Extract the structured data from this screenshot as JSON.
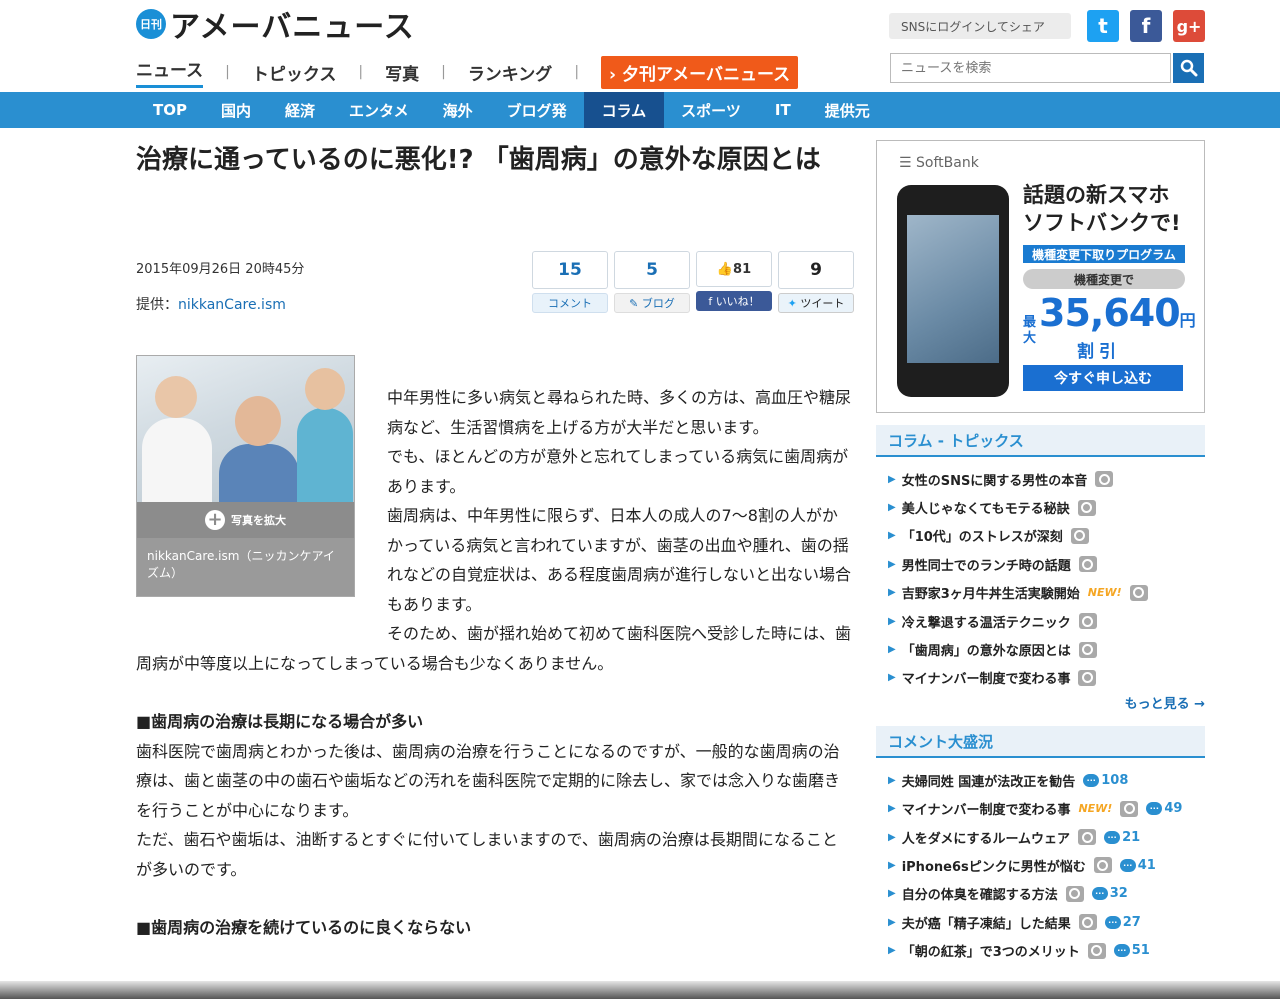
{
  "header": {
    "logo_badge": "日刊",
    "logo_text": "アメーバニュース",
    "share_label": "SNSにログインしてシェア",
    "sns": {
      "twitter": "t",
      "facebook": "f",
      "google": "g+"
    },
    "search_placeholder": "ニュースを検索",
    "nav": [
      "ニュース",
      "トピックス",
      "写真",
      "ランキング"
    ],
    "yukan_label": "夕刊アメーバニュース"
  },
  "categories": [
    "TOP",
    "国内",
    "経済",
    "エンタメ",
    "海外",
    "ブログ発",
    "コラム",
    "スポーツ",
    "IT",
    "提供元"
  ],
  "article": {
    "title": "治療に通っているのに悪化!? 「歯周病」の意外な原因とは",
    "date": "2015年09月26日 20時45分",
    "source_label": "提供：",
    "source_name": "nikkanCare.ism",
    "counts": {
      "comment": "15",
      "comment_label": "コメント",
      "blog": "5",
      "blog_label": "ブログ",
      "like": "81",
      "like_label": "いいね！",
      "tweet": "9",
      "tweet_label": "ツイート"
    },
    "photo_enlarge": "写真を拡大",
    "photo_caption": "nikkanCare.ism（ニッカンケアイズム）",
    "paragraphs": [
      "中年男性に多い病気と尋ねられた時、多くの方は、高血圧や糖尿病など、生活習慣病を上げる方が大半だと思います。",
      "でも、ほとんどの方が意外と忘れてしまっている病気に歯周病があります。",
      "歯周病は、中年男性に限らず、日本人の成人の7〜8割の人がかかっている病気と言われていますが、歯茎の出血や腫れ、歯の揺れなどの自覚症状は、ある程度歯周病が進行しないと出ない場合もあります。",
      "そのため、歯が揺れ始めて初めて歯科医院へ受診した時には、歯周病が中等度以上になってしまっている場合も少なくありません。"
    ],
    "heading1": "■歯周病の治療は長期になる場合が多い",
    "paragraphs2": [
      "歯科医院で歯周病とわかった後は、歯周病の治療を行うことになるのですが、一般的な歯周病の治療は、歯と歯茎の中の歯石や歯垢などの汚れを歯科医院で定期的に除去し、家では念入りな歯磨きを行うことが中心になります。",
      "ただ、歯石や歯垢は、油断するとすぐに付いてしまいますので、歯周病の治療は長期間になることが多いのです。"
    ],
    "heading2": "■歯周病の治療を続けているのに良くならない"
  },
  "ad": {
    "brand": "SoftBank",
    "headline1": "話題の新スマホ",
    "headline2": "ソフトバンクで!",
    "program": "機種変更下取りプログラム",
    "change": "機種変更で",
    "price_prefix": "最大",
    "price": "35,640",
    "price_unit": "円",
    "discount": "割引",
    "cta": "今すぐ申し込む"
  },
  "topics": {
    "title": "コラム - トピックス",
    "items": [
      "女性のSNSに関する男性の本音",
      "美人じゃなくてもモテる秘訣",
      "「10代」のストレスが深刻",
      "男性同士でのランチ時の話題",
      "吉野家3ヶ月牛丼生活実験開始",
      "冷え撃退する温活テクニック",
      "「歯周病」の意外な原因とは",
      "マイナンバー制度で変わる事"
    ],
    "new_label": "NEW!",
    "more": "もっと見る →"
  },
  "comments": {
    "title": "コメント大盛況",
    "items": [
      {
        "label": "夫婦同姓 国連が法改正を勧告",
        "count": "108"
      },
      {
        "label": "マイナンバー制度で変わる事",
        "count": "49"
      },
      {
        "label": "人をダメにするルームウェア",
        "count": "21"
      },
      {
        "label": "iPhone6sピンクに男性が悩む",
        "count": "41"
      },
      {
        "label": "自分の体臭を確認する方法",
        "count": "32"
      },
      {
        "label": "夫が癌「精子凍結」した結果",
        "count": "27"
      },
      {
        "label": "「朝の紅茶」で3つのメリット",
        "count": "51"
      }
    ]
  },
  "colors": {
    "accent": "#2a8fd0",
    "nav_active": "#17508f",
    "yukan": "#f05a1a"
  }
}
